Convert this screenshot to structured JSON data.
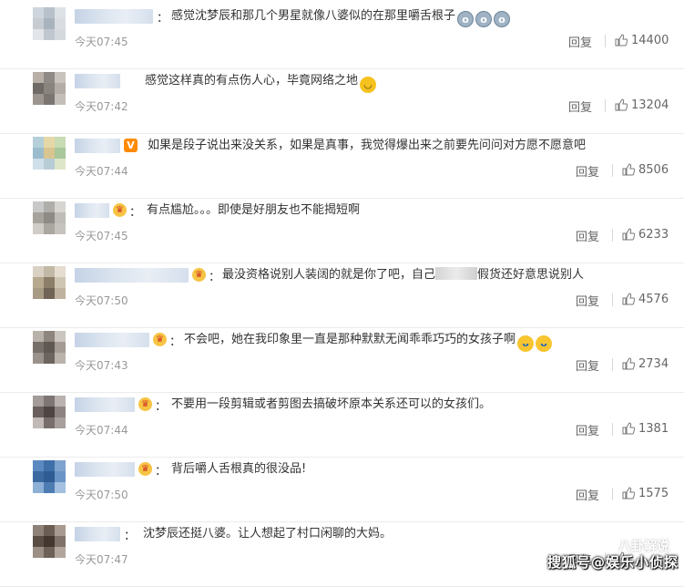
{
  "labels": {
    "reply": "回复"
  },
  "comments": [
    {
      "time": "今天07:45",
      "text": "感觉沈梦辰和那几个男星就像八婆似的在那里嚼舌根子",
      "likes": "14400",
      "emojis": [
        {
          "name": "shocked-emoji-icon",
          "type": "shock"
        },
        {
          "name": "shocked-emoji-icon",
          "type": "shock"
        },
        {
          "name": "shocked-emoji-icon",
          "type": "shock"
        }
      ],
      "badge": "none",
      "avatar": [
        "#cfd5dc",
        "#b8c0c9",
        "#dde2e7",
        "#c7ccd3",
        "#a9b3bd",
        "#d9dde2",
        "#e2e5e9",
        "#c0c7cf",
        "#d4d9de"
      ]
    },
    {
      "time": "今天07:42",
      "text": "感觉这样真的有点伤人心，毕竟网络之地",
      "likes": "13204",
      "emojis": [
        {
          "name": "smug-emoji-icon",
          "type": "cool"
        }
      ],
      "badge": "none",
      "avatar": [
        "#b9b0a8",
        "#8f8a86",
        "#c9c3bd",
        "#6f6a66",
        "#8a847f",
        "#b3aca6",
        "#9c958f",
        "#7b7571",
        "#c4beb8"
      ]
    },
    {
      "time": "今天07:44",
      "text": "如果是段子说出来没关系，如果是真事，我觉得爆出来之前要先问问对方愿不愿意吧",
      "likes": "8506",
      "emojis": [],
      "badge": "v",
      "avatar": [
        "#b5cfd9",
        "#e6d7a8",
        "#c7dbb4",
        "#9bbccc",
        "#d9c58f",
        "#a8c79a",
        "#cfe0e8",
        "#b8ccd6",
        "#dde6c9"
      ]
    },
    {
      "time": "今天07:45",
      "text": "有点尴尬。。。即使是好朋友也不能揭短啊",
      "likes": "6233",
      "emojis": [],
      "badge": "crown",
      "avatar": [
        "#c8c8c8",
        "#b0aeaa",
        "#d7d5d1",
        "#a6a29c",
        "#8e8a85",
        "#bfbcb7",
        "#d0cdc8",
        "#aaa6a0",
        "#c6c3be"
      ]
    },
    {
      "time": "今天07:50",
      "text_pre": "最没资格说别人装阔的就是你了吧，自己",
      "text_post": "假货还好意思说别人",
      "likes": "4576",
      "emojis": [],
      "badge": "crown",
      "avatar": [
        "#d9d2c4",
        "#c2b8a6",
        "#e4ddd0",
        "#b7a98f",
        "#8c7f6a",
        "#cfc5b3",
        "#a89b86",
        "#6f6455",
        "#bfb39f"
      ]
    },
    {
      "time": "今天07:43",
      "text": "不会吧，她在我印象里一直是那种默默无闻乖乖巧巧的女孩子啊",
      "likes": "2734",
      "emojis": [
        {
          "name": "laughing-emoji-icon",
          "type": "laugh"
        },
        {
          "name": "laughing-emoji-icon",
          "type": "laugh"
        }
      ],
      "badge": "crown",
      "avatar": [
        "#b9b2ab",
        "#8d857e",
        "#cbc5bf",
        "#766e68",
        "#5f5852",
        "#a39b94",
        "#9a928b",
        "#6c655f",
        "#bab3ac"
      ]
    },
    {
      "time": "今天07:44",
      "text": "不要用一段剪辑或者剪图去搞破坏原本关系还可以的女孩们。",
      "likes": "1381",
      "emojis": [],
      "badge": "crown",
      "avatar": [
        "#a39c99",
        "#7e7674",
        "#b9b2af",
        "#6a5f5d",
        "#4f4644",
        "#8d8481",
        "#c1bab7",
        "#786f6c",
        "#a8a09d"
      ]
    },
    {
      "time": "今天07:50",
      "text": "背后嚼人舌根真的很没品!",
      "likes": "1575",
      "emojis": [],
      "badge": "crown",
      "avatar": [
        "#5a88c0",
        "#3f6fa8",
        "#7ea3cf",
        "#3b6aa0",
        "#2f5c93",
        "#6a94c6",
        "#8fb0d6",
        "#4d7cb3",
        "#a4c0e0"
      ]
    },
    {
      "time": "今天07:47",
      "text": "沈梦辰还挺八婆。让人想起了村口闲聊的大妈。",
      "likes": "",
      "emojis": [],
      "badge": "none",
      "avatar": [
        "#8f8278",
        "#6b5e55",
        "#a79a90",
        "#5a4d45",
        "#43372f",
        "#7f726a",
        "#9c8f86",
        "#6e6158",
        "#b2a69c"
      ]
    }
  ],
  "watermark": {
    "top": "八卦解说",
    "bottom": "搜狐号@娱乐小侦探"
  }
}
